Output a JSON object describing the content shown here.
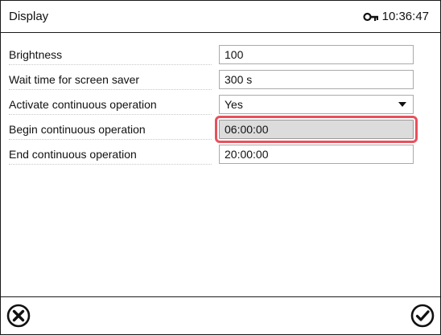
{
  "header": {
    "title": "Display",
    "time": "10:36:47",
    "icons": {
      "lock": "key-icon"
    }
  },
  "rows": [
    {
      "label": "Brightness",
      "value": "100"
    },
    {
      "label": "Wait time for screen saver",
      "value": "300 s"
    },
    {
      "label": "Activate continuous operation",
      "value": "Yes",
      "type": "select"
    },
    {
      "label": "Begin continuous operation",
      "value": "06:00:00",
      "selected": true
    },
    {
      "label": "End continuous operation",
      "value": "20:00:00"
    }
  ],
  "footer": {
    "icons": {
      "cancel": "close-circle-icon",
      "confirm": "check-circle-icon"
    }
  },
  "colors": {
    "highlight": "#e8505b",
    "field_selected_bg": "#dcdcdc"
  }
}
